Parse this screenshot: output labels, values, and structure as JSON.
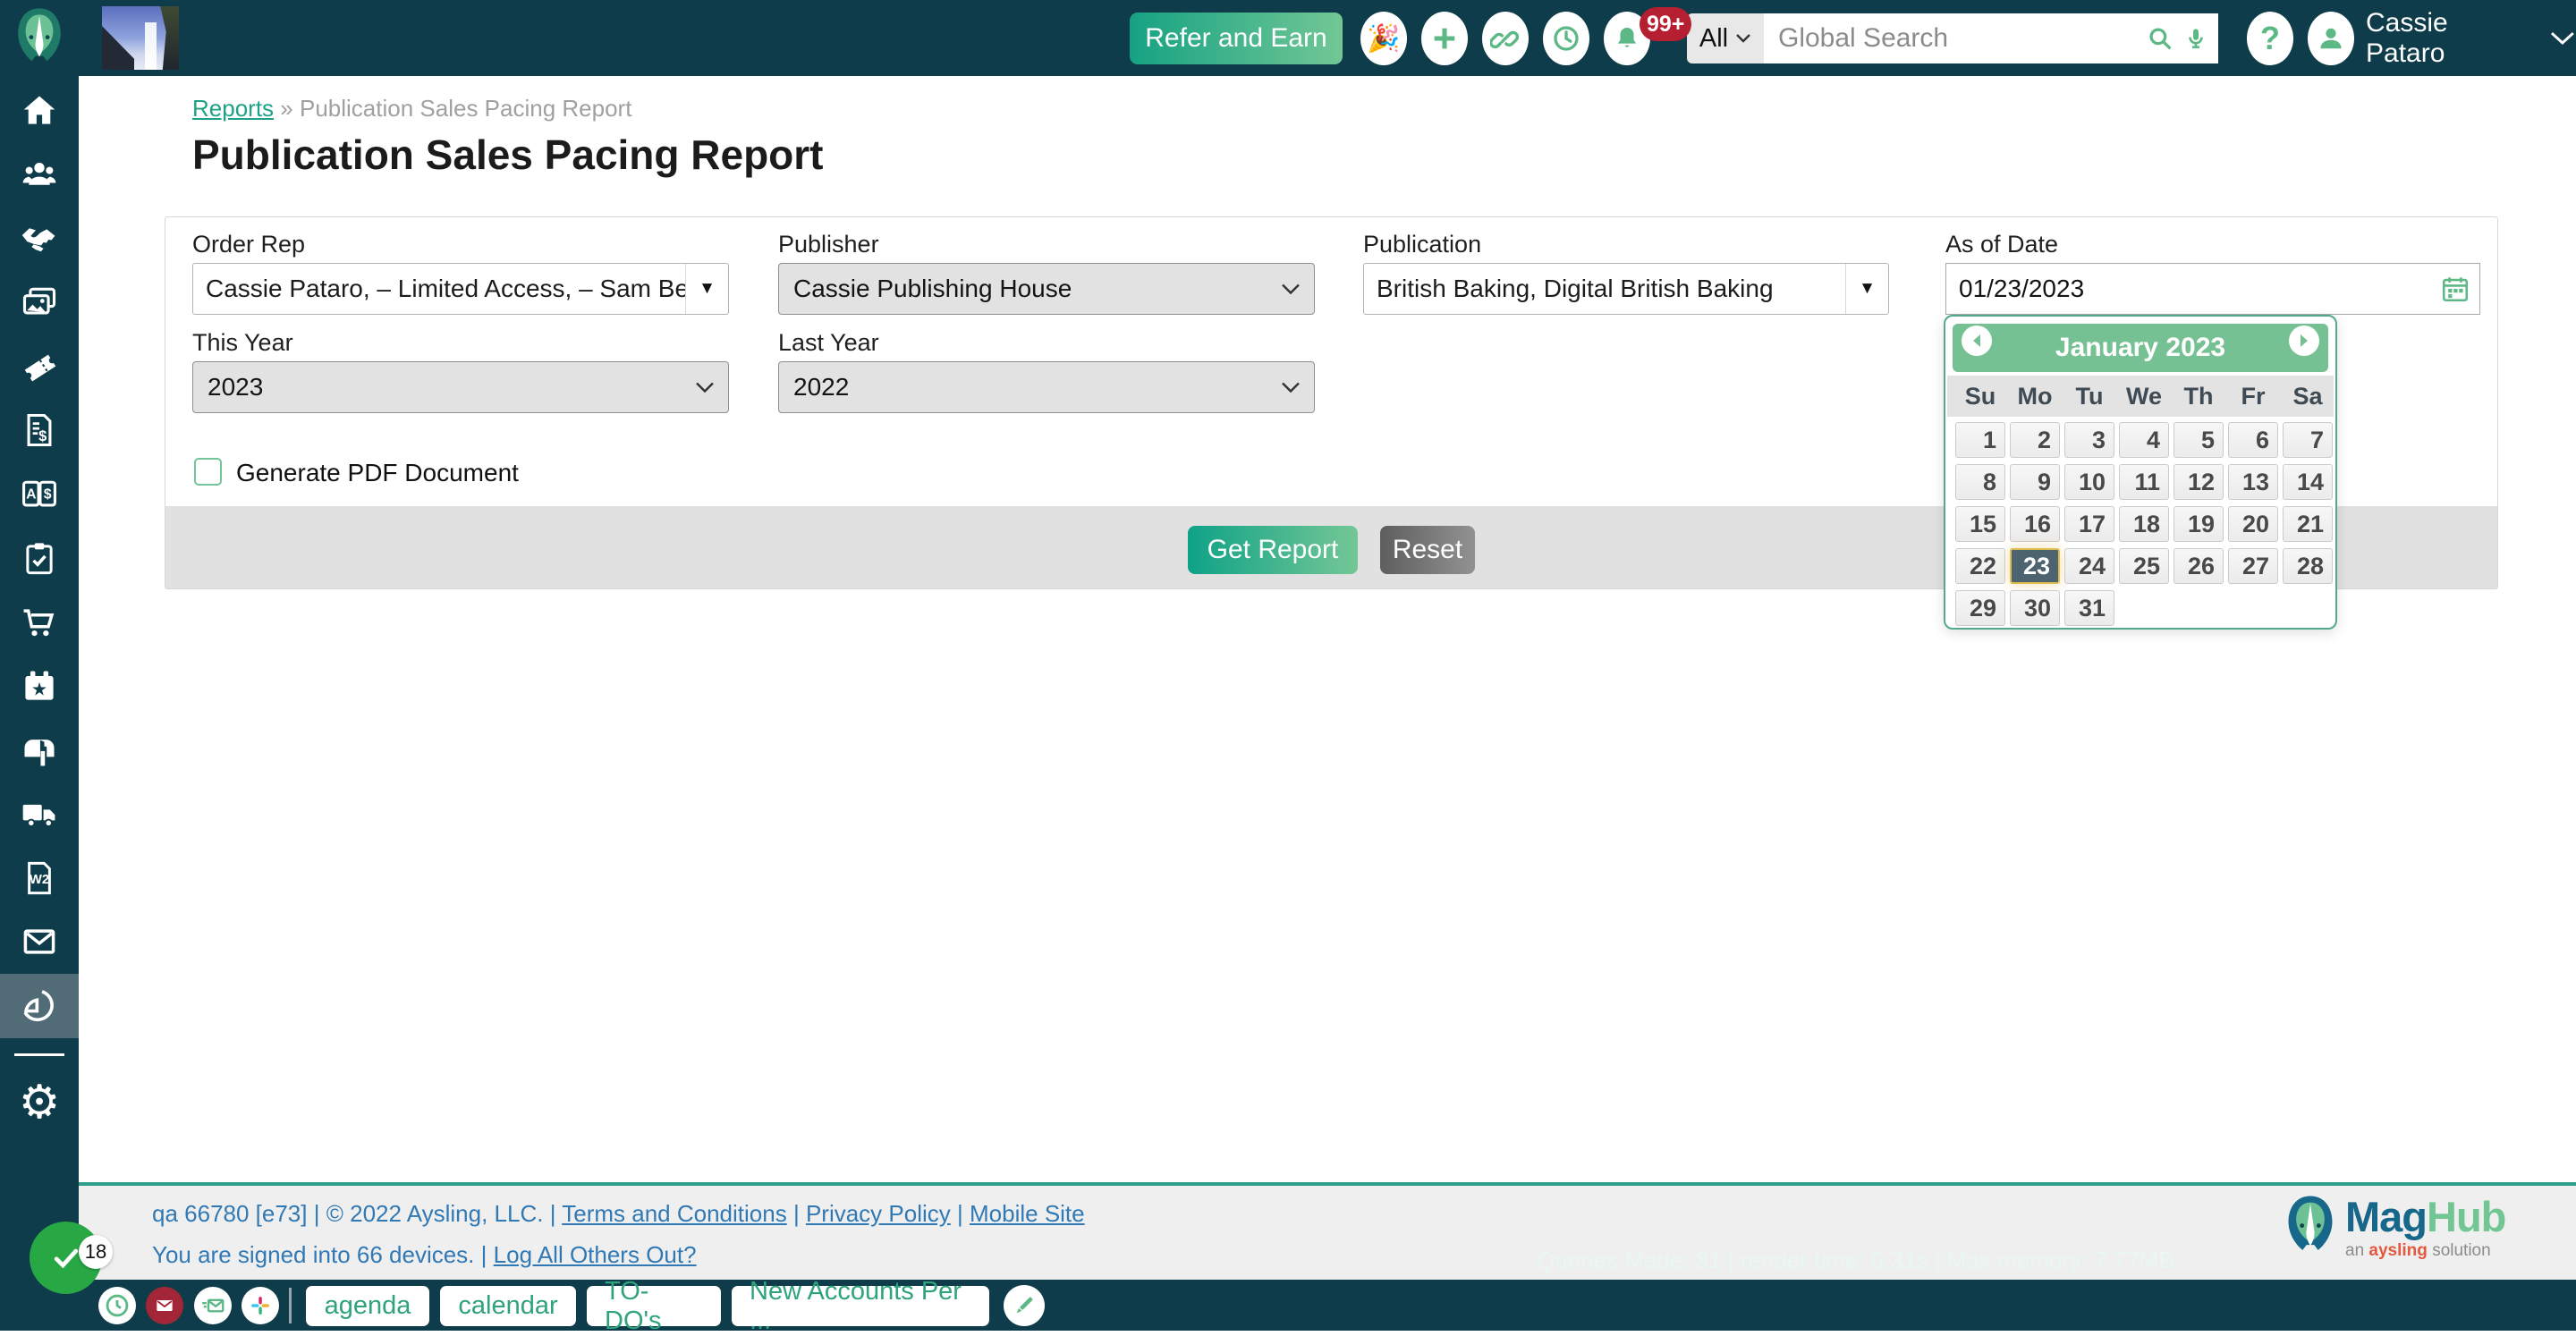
{
  "header": {
    "refer_button": "Refer and Earn",
    "search_scope": "All",
    "search_placeholder": "Global Search",
    "notification_count": "99+",
    "user_name": "Cassie Pataro",
    "party_emoji": "🎉",
    "help_glyph": "?"
  },
  "breadcrumb": {
    "parent": "Reports",
    "separator": "»",
    "current": "Publication Sales Pacing Report"
  },
  "page": {
    "title": "Publication Sales Pacing Report"
  },
  "form": {
    "order_rep": {
      "label": "Order Rep",
      "value": "Cassie Pataro, – Limited Access, – Sam Be..."
    },
    "publisher": {
      "label": "Publisher",
      "value": "Cassie Publishing House"
    },
    "publication": {
      "label": "Publication",
      "value": "British Baking, Digital British Baking"
    },
    "as_of_date": {
      "label": "As of Date",
      "value": "01/23/2023"
    },
    "this_year": {
      "label": "This Year",
      "value": "2023"
    },
    "last_year": {
      "label": "Last Year",
      "value": "2022"
    },
    "generate_pdf_label": "Generate PDF Document",
    "pdf_checked": false,
    "get_report_button": "Get Report",
    "reset_button": "Reset",
    "dropdown_glyph": "▼"
  },
  "datepicker": {
    "month_title": "January 2023",
    "day_headers": [
      "Su",
      "Mo",
      "Tu",
      "We",
      "Th",
      "Fr",
      "Sa"
    ],
    "days": [
      1,
      2,
      3,
      4,
      5,
      6,
      7,
      8,
      9,
      10,
      11,
      12,
      13,
      14,
      15,
      16,
      17,
      18,
      19,
      20,
      21,
      22,
      23,
      24,
      25,
      26,
      27,
      28,
      29,
      30,
      31
    ],
    "start_offset": 0,
    "selected_day": 23
  },
  "sidebar": {
    "icons": [
      "home-icon",
      "users-icon",
      "handshake-icon",
      "images-icon",
      "ticket-icon",
      "invoice-icon",
      "price-book-icon",
      "clipboard-check-icon",
      "cart-icon",
      "calendar-star-icon",
      "mailbox-icon",
      "delivery-truck-icon",
      "w2-document-icon",
      "mail-icon",
      "reports-pie-icon",
      "settings-gear-icon"
    ],
    "active_item": "reports-pie-icon"
  },
  "footer": {
    "build": "qa 66780 [e73]",
    "pipe": "|",
    "copyright": "© 2022 Aysling, LLC.",
    "link_terms": "Terms and Conditions",
    "link_privacy": "Privacy Policy",
    "link_mobile": "Mobile Site",
    "devices_text": "You are signed into 66 devices.",
    "logout_link": "Log All Others Out?",
    "debug_text": "Queries Made: 81 | render time: 0.31s | Max memory: 7.77MB",
    "logo_mag": "Mag",
    "logo_hub": "Hub",
    "logo_sub_prefix": "an",
    "logo_sub_brand": "aysling",
    "logo_sub_suffix": "solution"
  },
  "taskbar": {
    "check_badge": "18",
    "buttons": [
      "agenda",
      "calendar",
      "TO-DO's",
      "New Accounts Per ..."
    ]
  },
  "colors": {
    "header_bg": "#0e3c4a",
    "accent_green": "#5cb885",
    "button_gradient_start": "#0fa287",
    "button_gradient_end": "#74c795",
    "calendar_header_green": "#76c193",
    "selected_day_bg": "#4d6470",
    "selected_day_border": "#ddbe4e",
    "footer_link_blue": "#3079b5",
    "footer_rule_green": "#2d9e88",
    "badge_red": "#b51f31",
    "gmail_red": "#a32638",
    "check_circle_green": "#28a745",
    "active_sidebar_bg": "#516b77"
  }
}
